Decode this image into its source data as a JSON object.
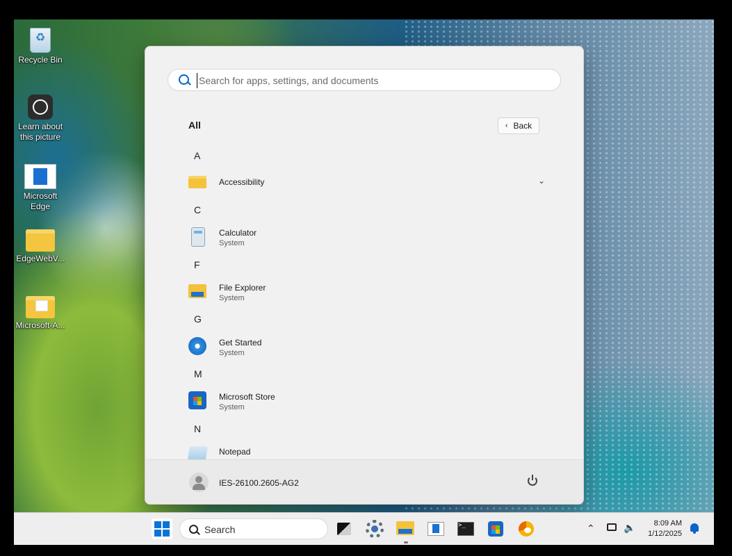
{
  "desktop": {
    "icons": [
      {
        "label": "Recycle Bin"
      },
      {
        "label": "Learn about this picture"
      },
      {
        "label": "Microsoft Edge"
      },
      {
        "label": "EdgeWebV..."
      },
      {
        "label": "Microsoft-A..."
      }
    ]
  },
  "start_menu": {
    "search_placeholder": "Search for apps, settings, and documents",
    "all_label": "All",
    "back_label": "Back",
    "letters": [
      "A",
      "C",
      "F",
      "G",
      "M",
      "N"
    ],
    "apps": [
      {
        "name": "Accessibility",
        "sub": "",
        "icon": "folder-icon"
      },
      {
        "name": "Calculator",
        "sub": "System",
        "icon": "calculator-icon"
      },
      {
        "name": "File Explorer",
        "sub": "System",
        "icon": "file-explorer-icon"
      },
      {
        "name": "Get Started",
        "sub": "System",
        "icon": "get-started-icon"
      },
      {
        "name": "Microsoft Store",
        "sub": "System",
        "icon": "store-icon"
      },
      {
        "name": "Notepad",
        "sub": "",
        "icon": "notepad-icon"
      }
    ],
    "user_name": "IES-26100.2605-AG2"
  },
  "taskbar": {
    "search_label": "Search",
    "time": "8:09 AM",
    "date": "1/12/2025",
    "terminal_glyph": ">_"
  }
}
